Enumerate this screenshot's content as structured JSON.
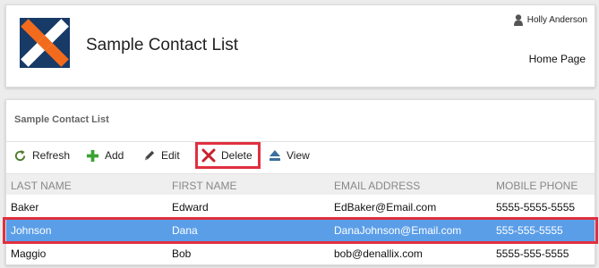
{
  "header": {
    "title": "Sample Contact List",
    "user_name": "Holly Anderson",
    "home_link": "Home Page"
  },
  "list": {
    "title": "Sample Contact List",
    "toolbar": {
      "refresh": "Refresh",
      "add": "Add",
      "edit": "Edit",
      "delete": "Delete",
      "view": "View"
    },
    "columns": [
      "LAST NAME",
      "FIRST NAME",
      "EMAIL ADDRESS",
      "MOBILE PHONE"
    ],
    "rows": [
      {
        "last": "Baker",
        "first": "Edward",
        "email": "EdBaker@Email.com",
        "phone": "5555-5555-5555"
      },
      {
        "last": "Johnson",
        "first": "Dana",
        "email": "DanaJohnson@Email.com",
        "phone": "555-555-5555"
      },
      {
        "last": "Maggio",
        "first": "Bob",
        "email": "bob@denallix.com",
        "phone": "5555-555-5555"
      }
    ],
    "selected_row_index": 1
  },
  "icons": {
    "logo": "x-logo",
    "user": "user-icon",
    "refresh": "refresh-icon",
    "add": "plus-icon",
    "edit": "pencil-icon",
    "delete": "x-icon",
    "view": "eject-icon"
  },
  "colors": {
    "logo_bg": "#173a67",
    "logo_orange": "#f26b1d",
    "selection": "#5b9ee8",
    "annotation": "#e0303f",
    "add_green": "#3aa335",
    "delete_red": "#c8202e",
    "view_blue": "#3b6f9e"
  }
}
